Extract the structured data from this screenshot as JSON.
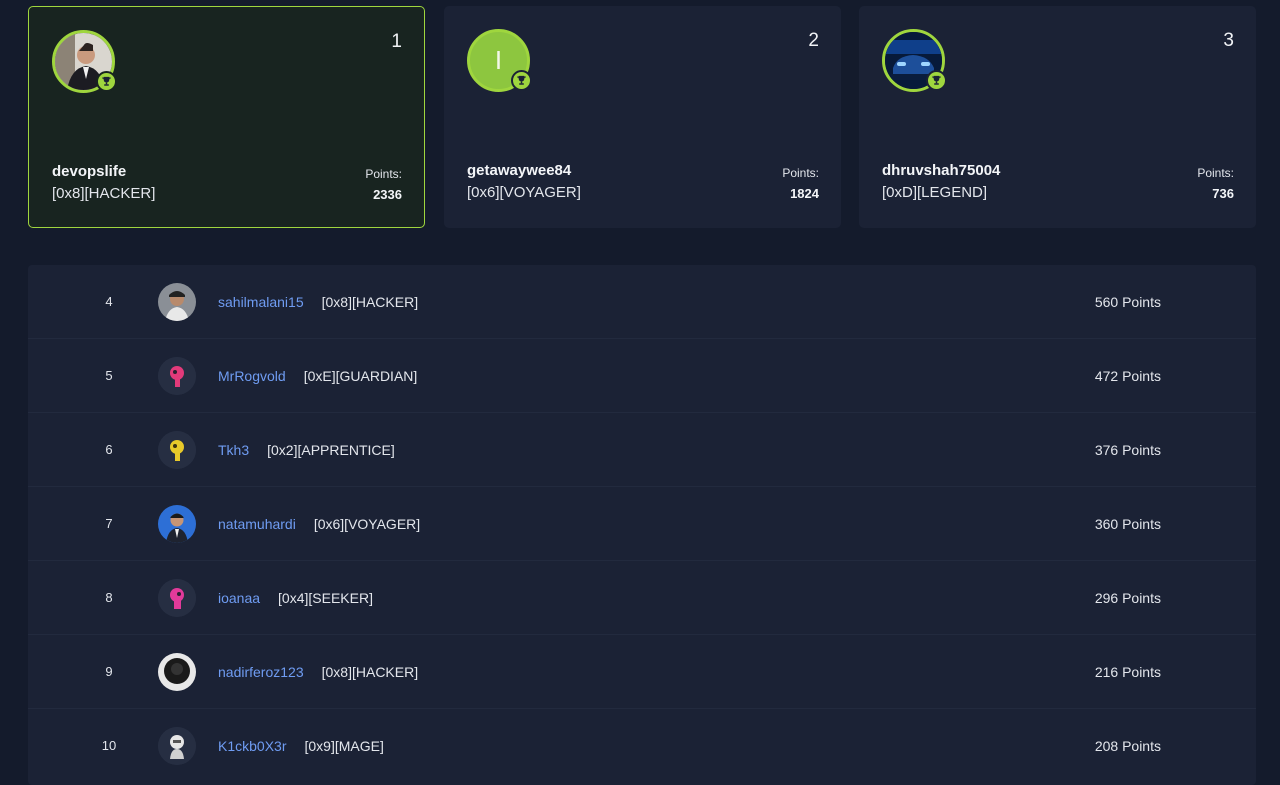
{
  "podium": [
    {
      "rank": "1",
      "username": "devopslife",
      "title": "[0x8][HACKER]",
      "points_label": "Points:",
      "points": "2336",
      "avatar": "person-photo-icon"
    },
    {
      "rank": "2",
      "username": "getawaywee84",
      "title": "[0x6][VOYAGER]",
      "points_label": "Points:",
      "points": "1824",
      "avatar": "letter-avatar-icon",
      "avatar_letter": "I"
    },
    {
      "rank": "3",
      "username": "dhruvshah75004",
      "title": "[0xD][LEGEND]",
      "points_label": "Points:",
      "points": "736",
      "avatar": "car-photo-icon"
    }
  ],
  "leaderboard": [
    {
      "rank": "4",
      "username": "sahilmalani15",
      "title": "[0x8][HACKER]",
      "points": "560 Points",
      "avatar": "person-photo-icon"
    },
    {
      "rank": "5",
      "username": "MrRogvold",
      "title": "[0xE][GUARDIAN]",
      "points": "472 Points",
      "avatar": "pink-robot-icon"
    },
    {
      "rank": "6",
      "username": "Tkh3",
      "title": "[0x2][APPRENTICE]",
      "points": "376 Points",
      "avatar": "yellow-robot-icon"
    },
    {
      "rank": "7",
      "username": "natamuhardi",
      "title": "[0x6][VOYAGER]",
      "points": "360 Points",
      "avatar": "person-photo-icon"
    },
    {
      "rank": "8",
      "username": "ioanaa",
      "title": "[0x4][SEEKER]",
      "points": "296 Points",
      "avatar": "pink-robot-icon"
    },
    {
      "rank": "9",
      "username": "nadirferoz123",
      "title": "[0x8][HACKER]",
      "points": "216 Points",
      "avatar": "dark-photo-icon"
    },
    {
      "rank": "10",
      "username": "K1ckb0X3r",
      "title": "[0x9][MAGE]",
      "points": "208 Points",
      "avatar": "white-robot-icon"
    }
  ],
  "colors": {
    "accent": "#9fd63e",
    "link": "#6f9cf2",
    "background": "#141b2c",
    "card": "#1b2235"
  }
}
